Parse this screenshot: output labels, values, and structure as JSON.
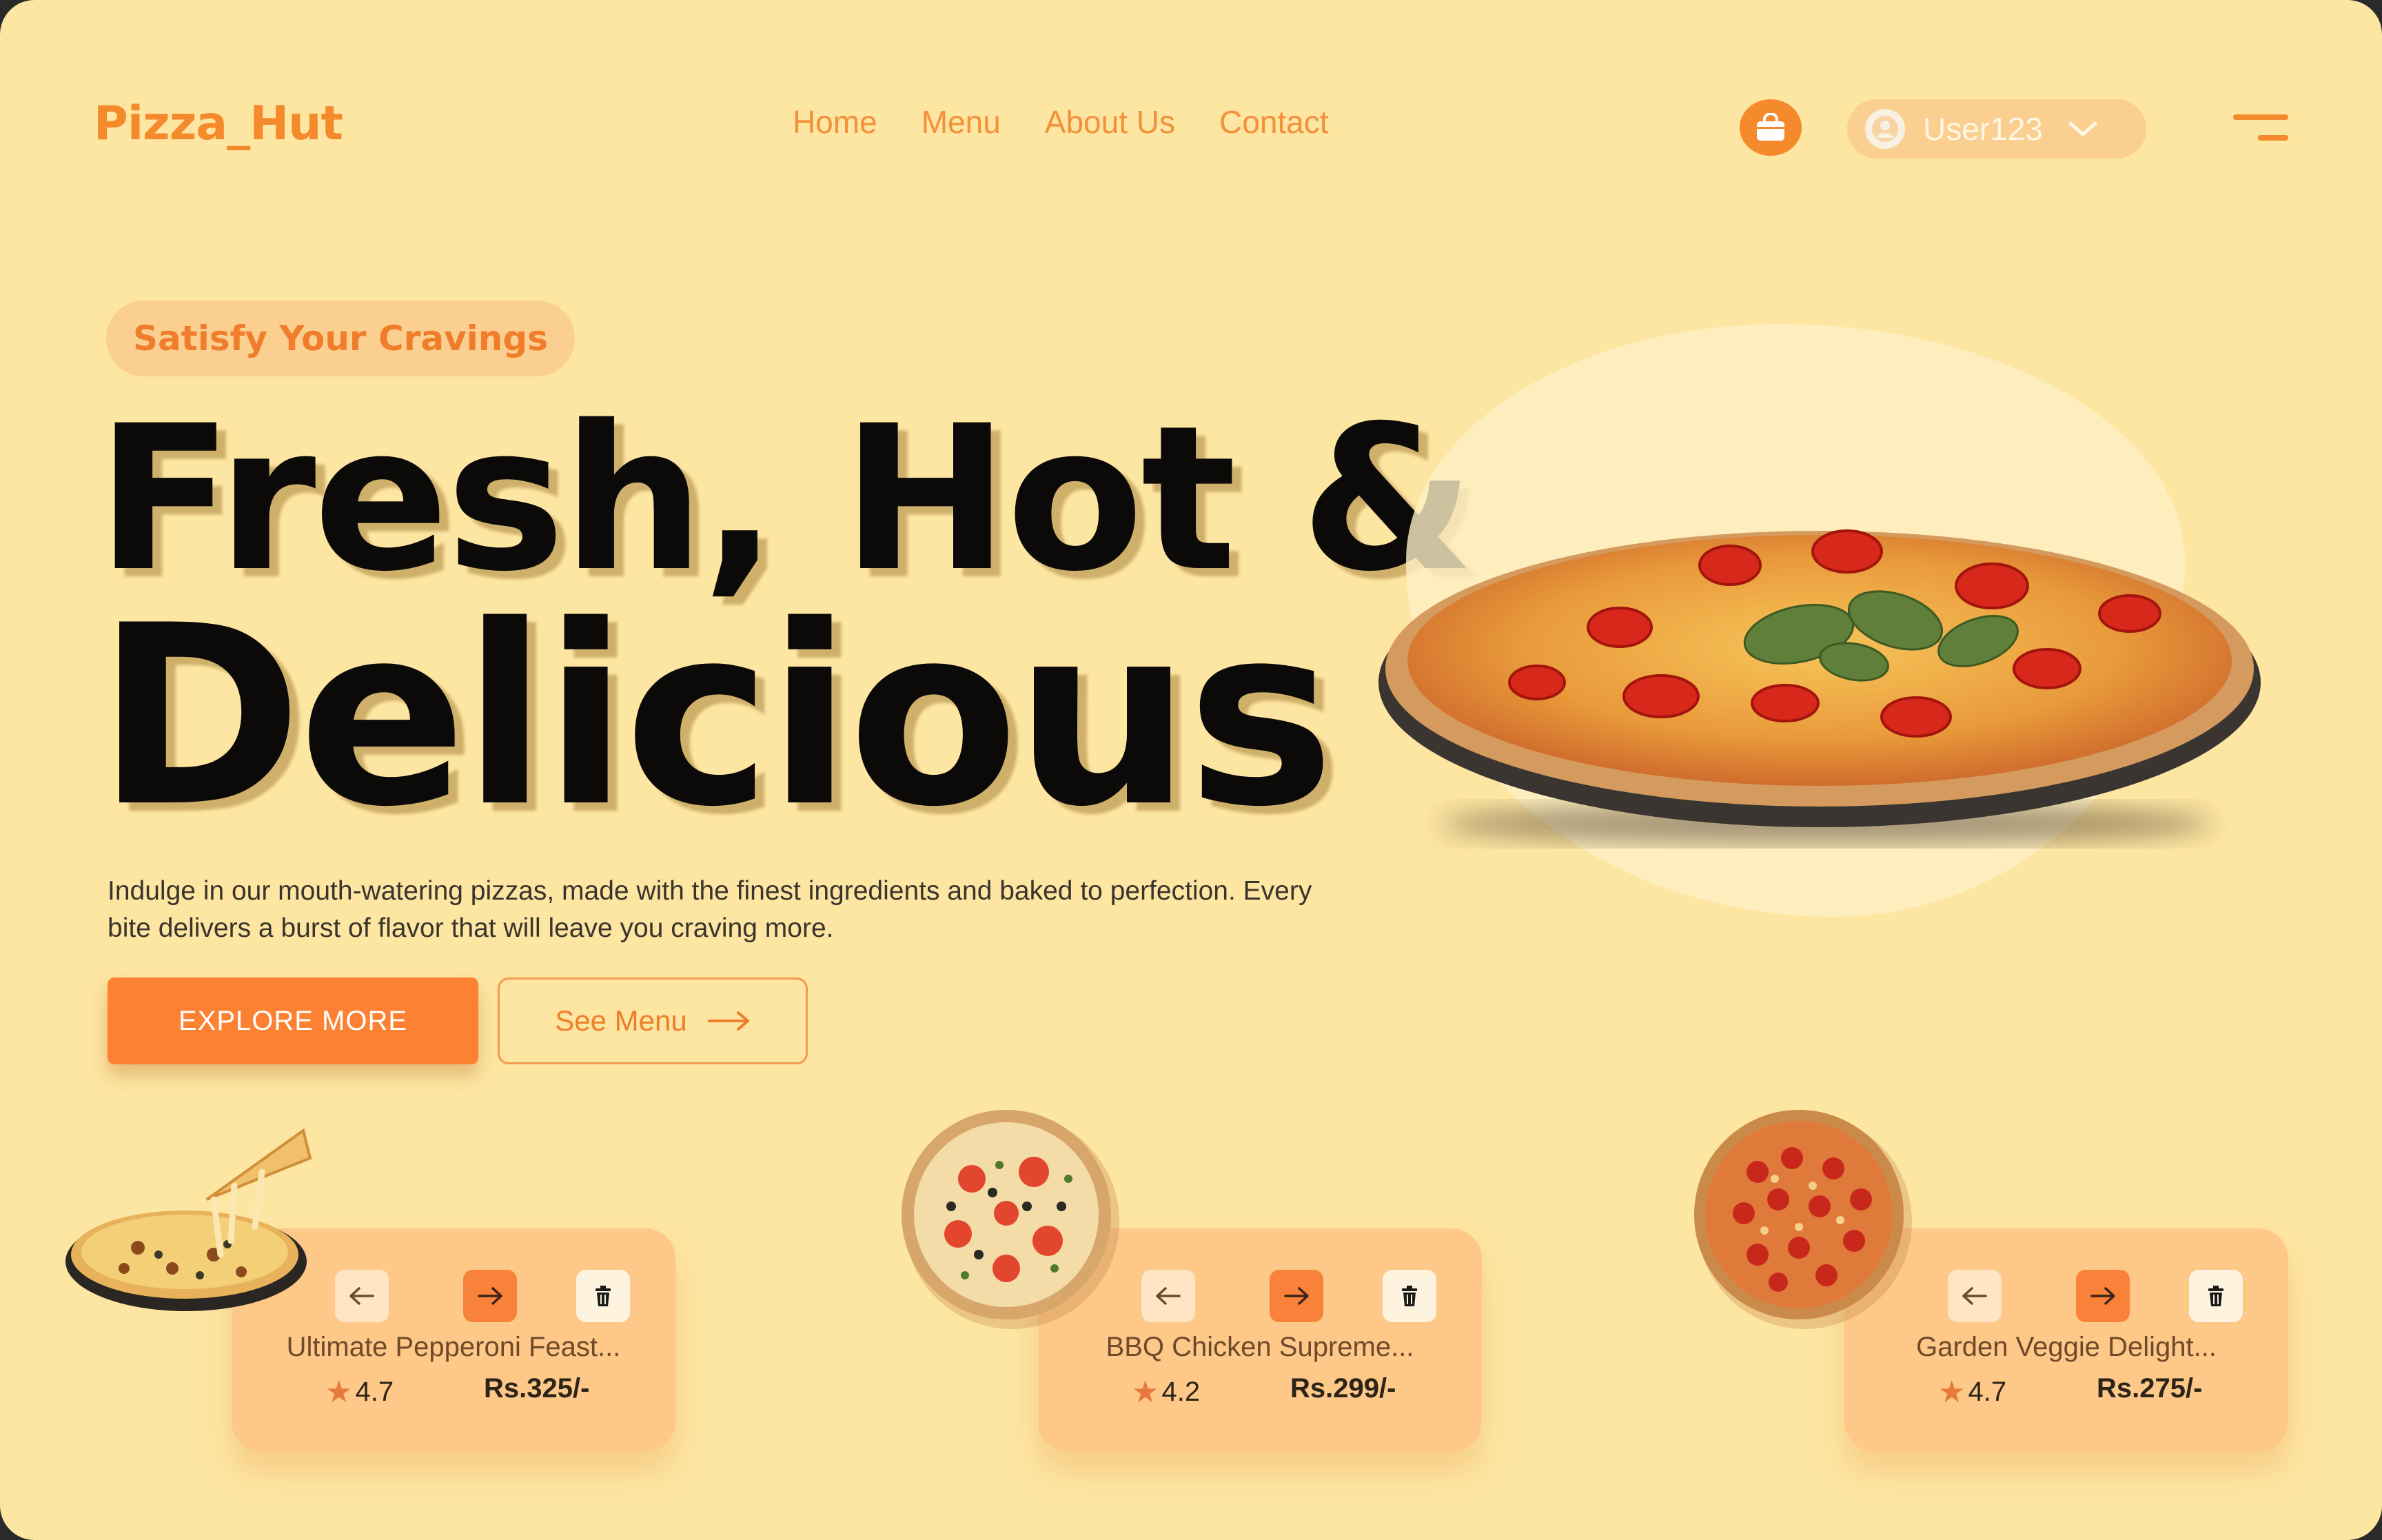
{
  "brand": {
    "logo": "Pizza_Hut"
  },
  "nav": {
    "items": [
      "Home",
      "Menu",
      "About Us",
      "Contact"
    ]
  },
  "header": {
    "user_name": "User123"
  },
  "hero": {
    "tagline": "Satisfy Your Cravings",
    "headline_line1": "Fresh, Hot &",
    "headline_line2": "Delicious",
    "description": "Indulge in our mouth-watering pizzas, made with the finest ingredients and baked to perfection. Every bite delivers a burst of flavor that will leave you craving more.",
    "primary_button": "EXPLORE MORE",
    "secondary_button": "See Menu"
  },
  "products": [
    {
      "name": "Ultimate Pepperoni Feast...",
      "rating": "4.7",
      "price": "Rs.325/-"
    },
    {
      "name": "BBQ Chicken Supreme...",
      "rating": "4.2",
      "price": "Rs.299/-"
    },
    {
      "name": "Garden Veggie Delight...",
      "rating": "4.7",
      "price": "Rs.275/-"
    }
  ],
  "colors": {
    "background": "#fde5a2",
    "accent": "#fd8132",
    "card": "#fdc888",
    "text": "#0c0a08"
  },
  "icons": [
    "shopping-bag-icon",
    "user-avatar-icon",
    "chevron-down-icon",
    "hamburger-menu-icon",
    "arrow-right-icon",
    "arrow-left-icon",
    "trash-icon",
    "star-icon"
  ]
}
